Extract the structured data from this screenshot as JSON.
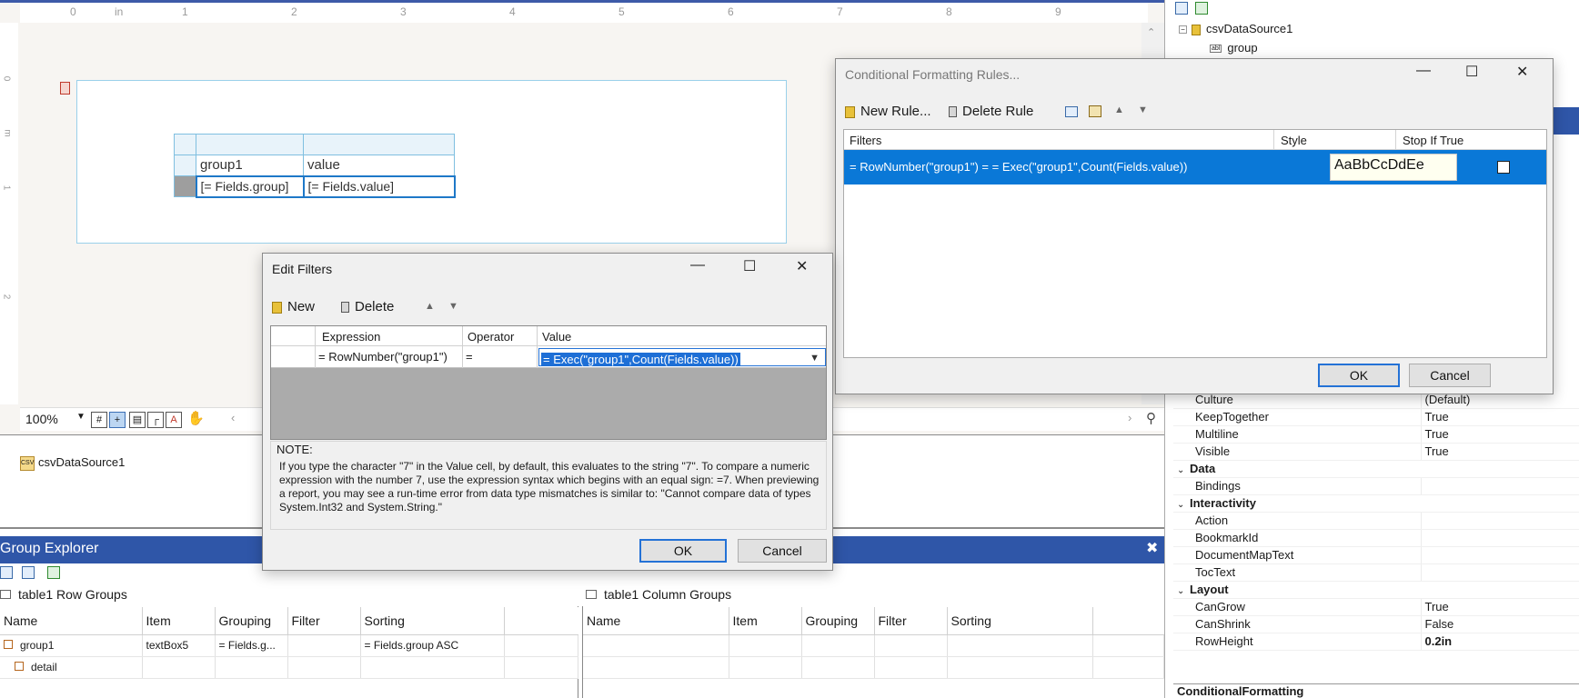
{
  "designer": {
    "ruler_labels": [
      "0",
      "in",
      "1",
      "2",
      "3",
      "4",
      "5",
      "6",
      "7",
      "8",
      "9"
    ],
    "vertical_ruler_labels": [
      "0",
      "m",
      "1",
      "2"
    ],
    "table": {
      "header_cells": [
        "group1",
        "value"
      ],
      "detail_cells": [
        "[= Fields.group]",
        "[= Fields.value]"
      ]
    },
    "zoom": "100%"
  },
  "data_source_tray": {
    "item": "csvDataSource1"
  },
  "group_explorer": {
    "title": "Group Explorer",
    "row_groups_title": "table1 Row Groups",
    "column_groups_title": "table1 Column Groups",
    "columns": [
      "Name",
      "Item",
      "Grouping",
      "Filter",
      "Sorting"
    ],
    "row_groups": [
      {
        "name": "group1",
        "item": "textBox5",
        "grouping": "= Fields.g...",
        "filter": "",
        "sorting": "= Fields.group ASC"
      },
      {
        "name": "detail",
        "item": "",
        "grouping": "",
        "filter": "",
        "sorting": ""
      }
    ]
  },
  "data_explorer": {
    "source": "csvDataSource1",
    "field": "group"
  },
  "properties": {
    "rows": [
      {
        "type": "prop",
        "name": "Culture",
        "value": "(Default)"
      },
      {
        "type": "prop",
        "name": "KeepTogether",
        "value": "True"
      },
      {
        "type": "prop",
        "name": "Multiline",
        "value": "True"
      },
      {
        "type": "prop",
        "name": "Visible",
        "value": "True"
      },
      {
        "type": "cat",
        "name": "Data"
      },
      {
        "type": "prop",
        "name": "Bindings",
        "value": ""
      },
      {
        "type": "cat",
        "name": "Interactivity"
      },
      {
        "type": "prop",
        "name": "Action",
        "value": ""
      },
      {
        "type": "prop",
        "name": "BookmarkId",
        "value": ""
      },
      {
        "type": "prop",
        "name": "DocumentMapText",
        "value": ""
      },
      {
        "type": "prop",
        "name": "TocText",
        "value": ""
      },
      {
        "type": "cat",
        "name": "Layout"
      },
      {
        "type": "prop",
        "name": "CanGrow",
        "value": "True"
      },
      {
        "type": "prop",
        "name": "CanShrink",
        "value": "False"
      },
      {
        "type": "prop",
        "name": "RowHeight",
        "value": "0.2in",
        "bold": true
      }
    ],
    "footer": "ConditionalFormatting"
  },
  "cfr_dialog": {
    "title": "Conditional Formatting Rules...",
    "new_rule": "New Rule...",
    "delete_rule": "Delete Rule",
    "columns": [
      "Filters",
      "Style",
      "Stop If True"
    ],
    "rule": {
      "filter": "= RowNumber(\"group1\") = = Exec(\"group1\",Count(Fields.value))",
      "style_preview": "AaBbCcDdEe",
      "stop_if_true": false
    },
    "ok": "OK",
    "cancel": "Cancel"
  },
  "edit_filters_dialog": {
    "title": "Edit Filters",
    "new": "New",
    "delete": "Delete",
    "columns": [
      "Expression",
      "Operator",
      "Value"
    ],
    "row": {
      "expression": "= RowNumber(\"group1\")",
      "operator": "=",
      "value": "= Exec(\"group1\",Count(Fields.value))"
    },
    "note_label": "NOTE:",
    "note_text": "If you type the character \"7\" in the Value cell, by default, this evaluates to the string \"7\". To compare a numeric expression with the number 7, use the expression syntax which begins with an equal sign: =7. When previewing a report, you may see a run-time error from data type mismatches is similar to: \"Cannot compare data of types System.Int32 and System.String.\"",
    "ok": "OK",
    "cancel": "Cancel"
  }
}
